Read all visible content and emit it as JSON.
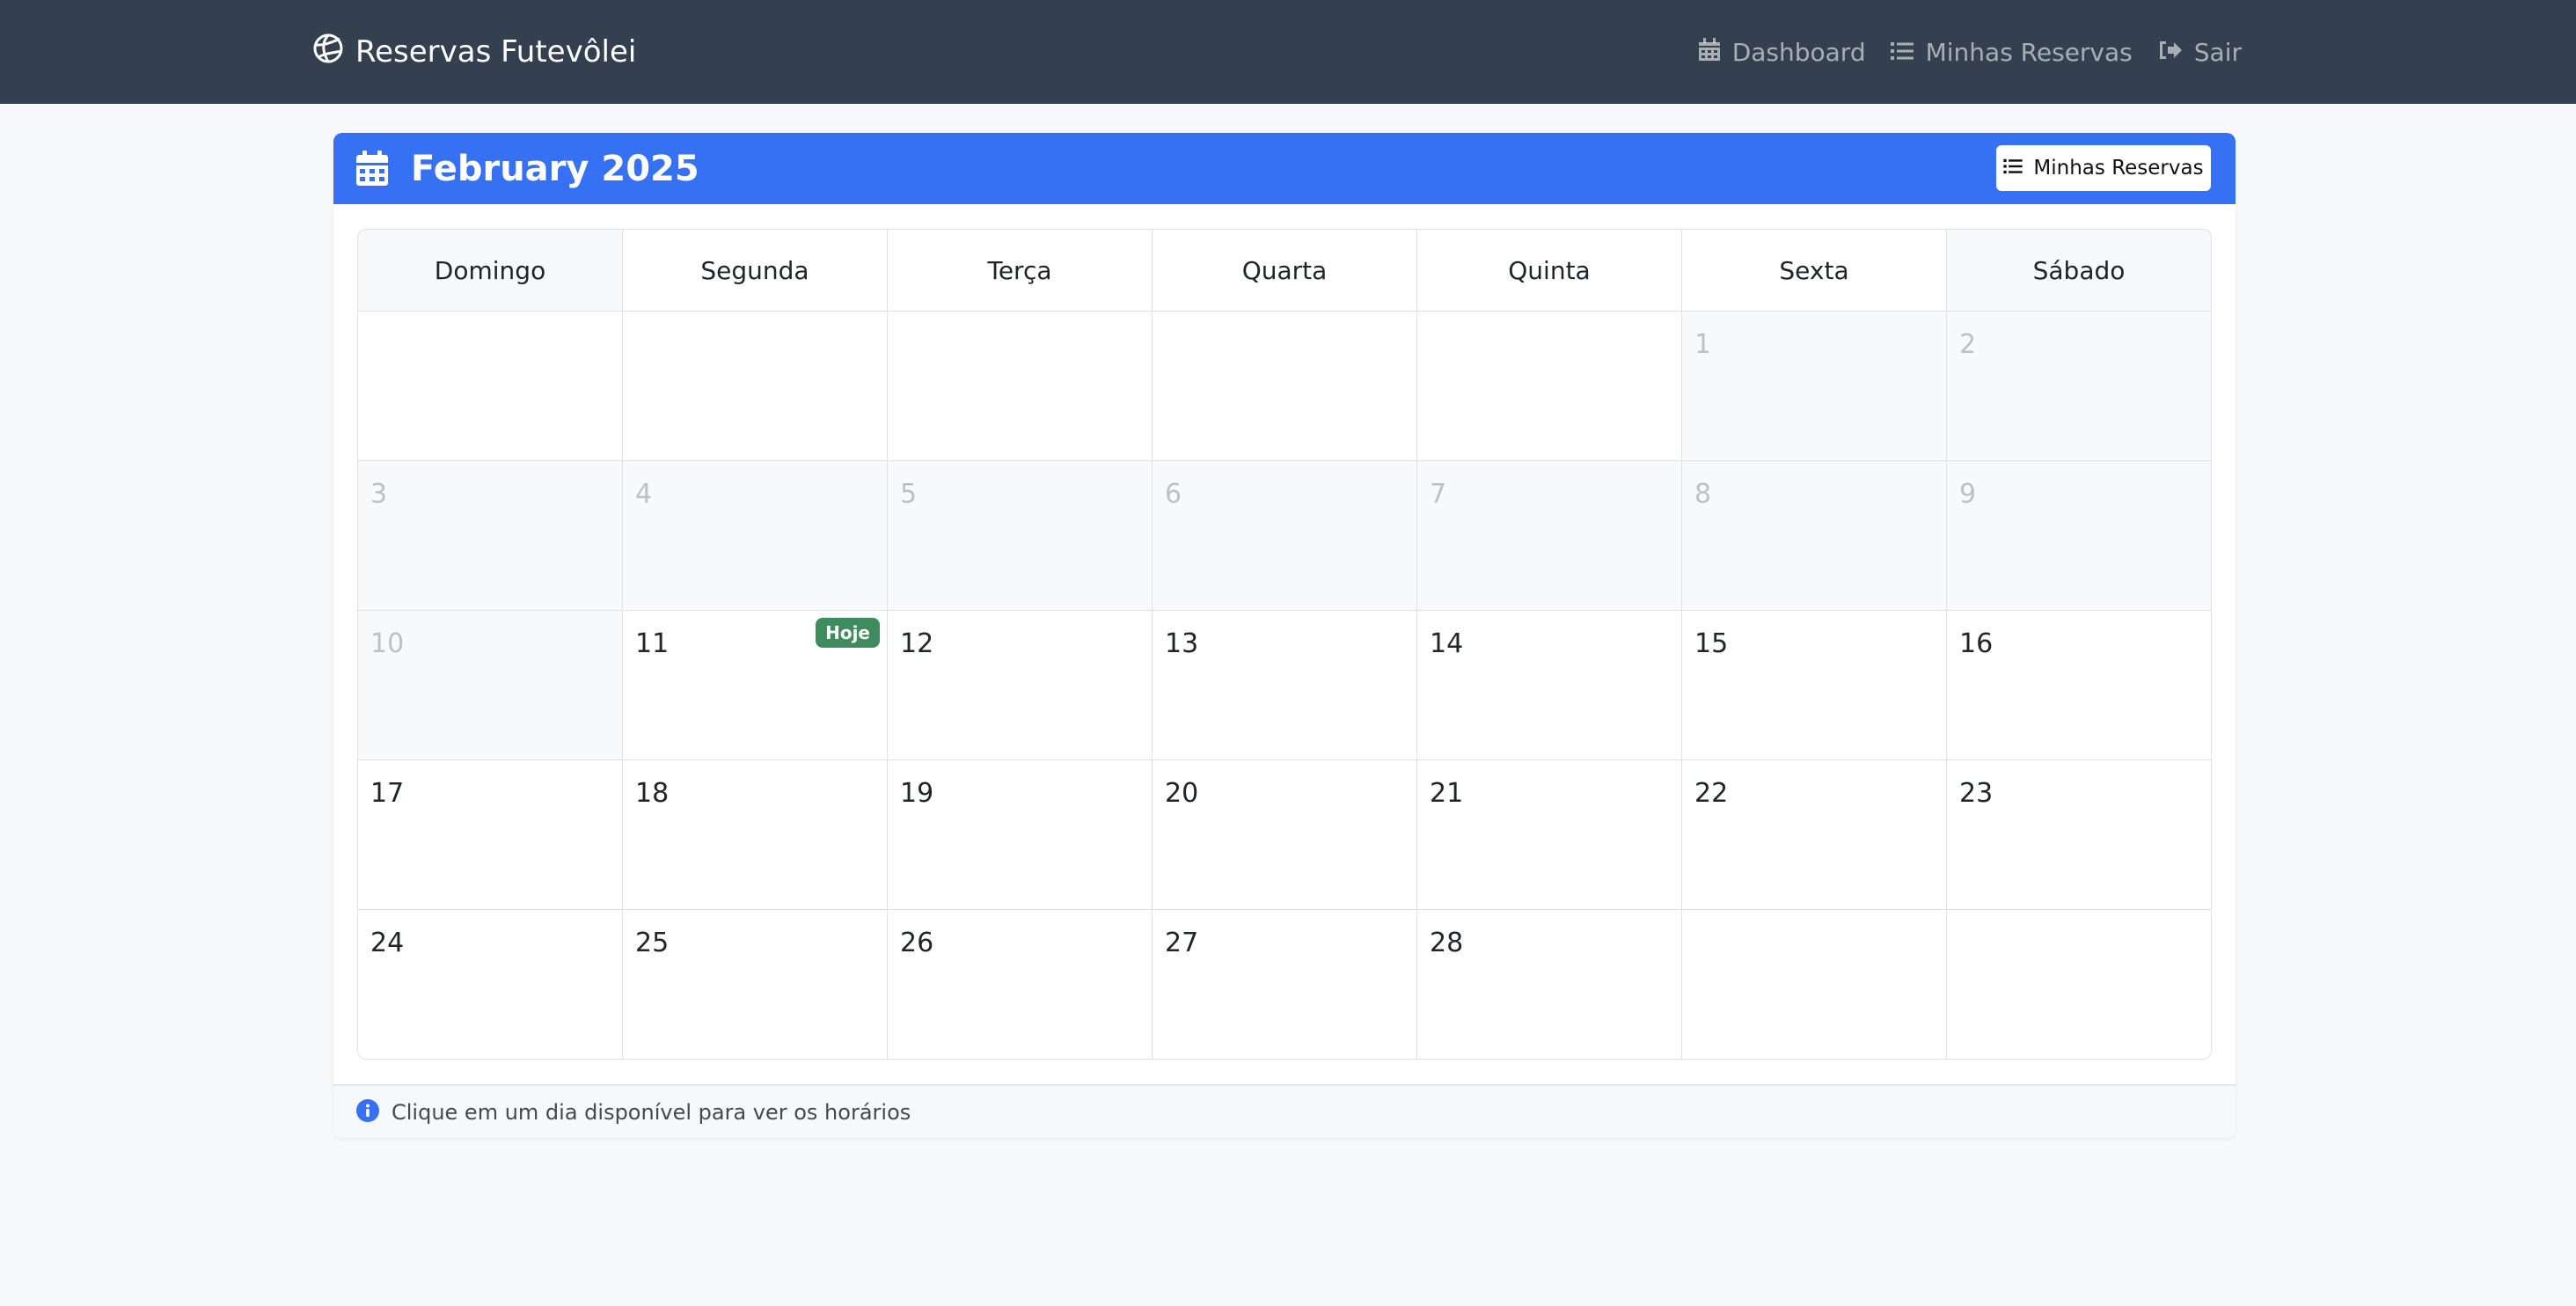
{
  "navbar": {
    "brand": "Reservas Futevôlei",
    "brand_icon": "volleyball-icon",
    "links": [
      {
        "label": "Dashboard",
        "icon": "calendar-icon"
      },
      {
        "label": "Minhas Reservas",
        "icon": "list-icon"
      },
      {
        "label": "Sair",
        "icon": "sign-out-icon"
      }
    ]
  },
  "calendar": {
    "title": "February 2025",
    "header_button": "Minhas Reservas",
    "weekdays": [
      "Domingo",
      "Segunda",
      "Terça",
      "Quarta",
      "Quinta",
      "Sexta",
      "Sábado"
    ],
    "weeks": [
      [
        "",
        "",
        "",
        "",
        "",
        "1",
        "2"
      ],
      [
        "3",
        "4",
        "5",
        "6",
        "7",
        "8",
        "9"
      ],
      [
        "10",
        "11",
        "12",
        "13",
        "14",
        "15",
        "16"
      ],
      [
        "17",
        "18",
        "19",
        "20",
        "21",
        "22",
        "23"
      ],
      [
        "24",
        "25",
        "26",
        "27",
        "28",
        "",
        ""
      ]
    ],
    "past_days": [
      "1",
      "2",
      "3",
      "4",
      "5",
      "6",
      "7",
      "8",
      "9",
      "10"
    ],
    "today": "11",
    "today_badge": "Hoje"
  },
  "footer": {
    "info_icon": "info-circle-icon",
    "text": "Clique em um dia disponível para ver os horários"
  },
  "colors": {
    "navbar_bg": "#343f4f",
    "header_bg": "#3571f2",
    "today_badge": "#3e8b5e",
    "info_icon": "#3571f2"
  }
}
